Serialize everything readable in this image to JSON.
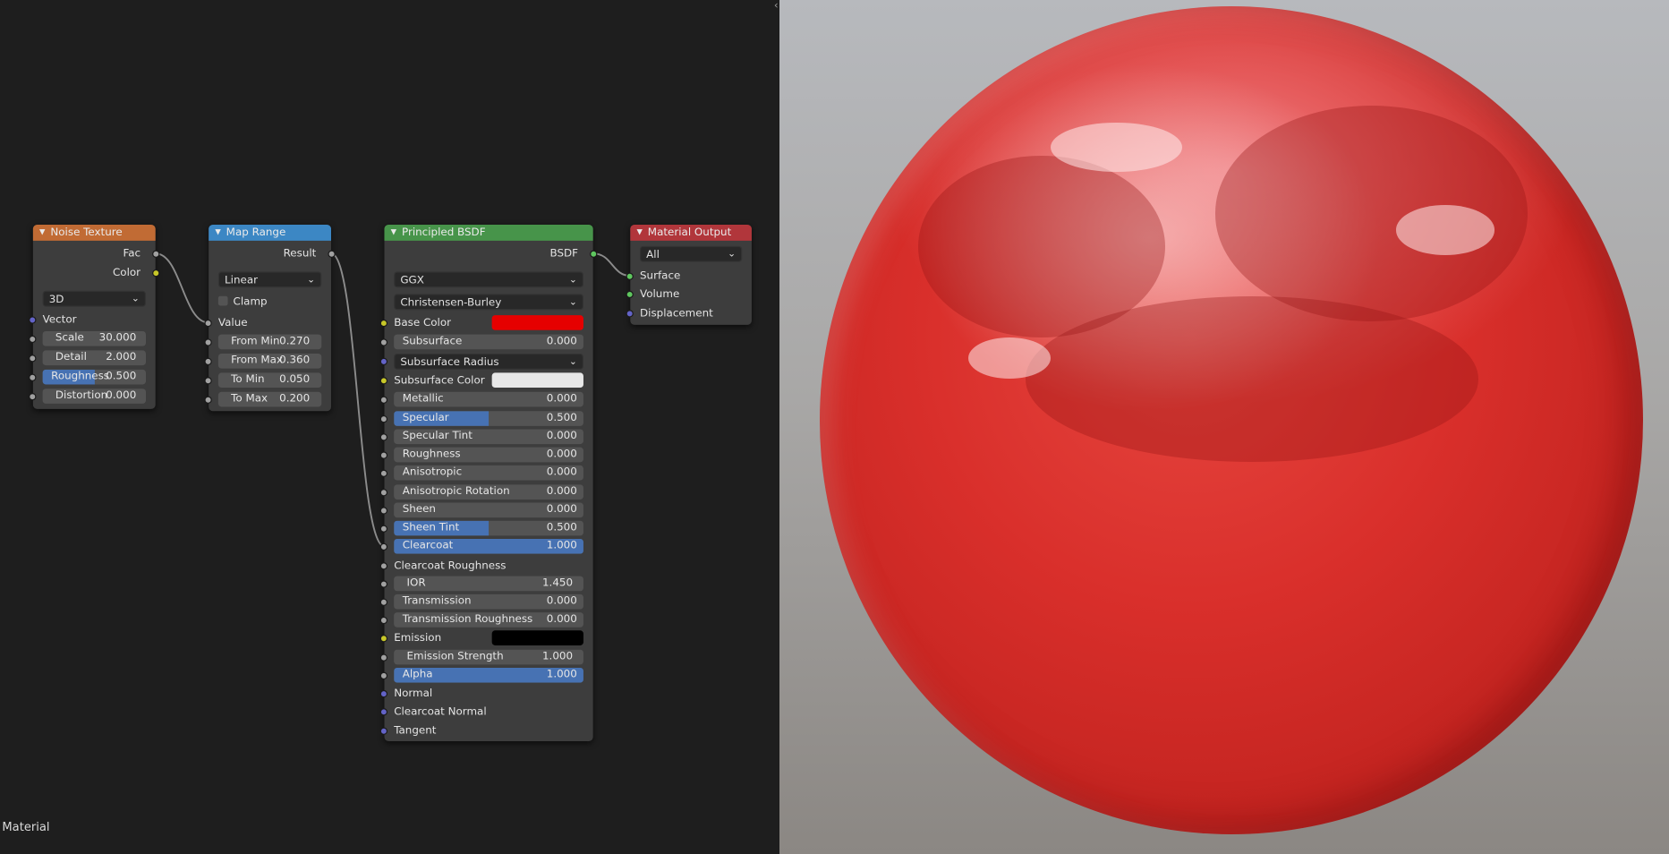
{
  "editor": {
    "label": "Material",
    "collapse_icon": "chevron-left-icon"
  },
  "colors": {
    "noise_header": "#c16b34",
    "map_range_header": "#3c87c4",
    "principled_header": "#47944a",
    "output_header": "#b1363b",
    "base_color": "#e60000",
    "subsurface_color": "#e8e8e8",
    "emission_color": "#000000",
    "slider_fill": "#4772b3"
  },
  "nodes": {
    "noise": {
      "title": "Noise Texture",
      "outputs": {
        "fac": "Fac",
        "color": "Color"
      },
      "dimension": "3D",
      "vector_label": "Vector",
      "scale": {
        "label": "Scale",
        "value": "30.000"
      },
      "detail": {
        "label": "Detail",
        "value": "2.000"
      },
      "roughness": {
        "label": "Roughness",
        "value": "0.500",
        "fill": 0.5
      },
      "distortion": {
        "label": "Distortion",
        "value": "0.000"
      }
    },
    "map_range": {
      "title": "Map Range",
      "output": "Result",
      "interpolation": "Linear",
      "clamp_label": "Clamp",
      "clamp_checked": false,
      "value_label": "Value",
      "from_min": {
        "label": "From Min",
        "value": "0.270"
      },
      "from_max": {
        "label": "From Max",
        "value": "0.360"
      },
      "to_min": {
        "label": "To Min",
        "value": "0.050"
      },
      "to_max": {
        "label": "To Max",
        "value": "0.200"
      }
    },
    "principled": {
      "title": "Principled BSDF",
      "output": "BSDF",
      "distribution": "GGX",
      "subsurface_method": "Christensen-Burley",
      "base_color_label": "Base Color",
      "subsurface": {
        "label": "Subsurface",
        "value": "0.000"
      },
      "subsurface_radius": "Subsurface Radius",
      "subsurface_color_label": "Subsurface Color",
      "metallic": {
        "label": "Metallic",
        "value": "0.000"
      },
      "specular": {
        "label": "Specular",
        "value": "0.500",
        "fill": 0.5
      },
      "specular_tint": {
        "label": "Specular Tint",
        "value": "0.000"
      },
      "roughness": {
        "label": "Roughness",
        "value": "0.000"
      },
      "anisotropic": {
        "label": "Anisotropic",
        "value": "0.000"
      },
      "anisotropic_rotation": {
        "label": "Anisotropic Rotation",
        "value": "0.000"
      },
      "sheen": {
        "label": "Sheen",
        "value": "0.000"
      },
      "sheen_tint": {
        "label": "Sheen Tint",
        "value": "0.500",
        "fill": 0.5
      },
      "clearcoat": {
        "label": "Clearcoat",
        "value": "1.000",
        "fill": 1.0
      },
      "clearcoat_roughness_label": "Clearcoat Roughness",
      "ior": {
        "label": "IOR",
        "value": "1.450"
      },
      "transmission": {
        "label": "Transmission",
        "value": "0.000"
      },
      "transmission_roughness": {
        "label": "Transmission Roughness",
        "value": "0.000"
      },
      "emission_label": "Emission",
      "emission_strength": {
        "label": "Emission Strength",
        "value": "1.000"
      },
      "alpha": {
        "label": "Alpha",
        "value": "1.000",
        "fill": 1.0
      },
      "normal_label": "Normal",
      "clearcoat_normal_label": "Clearcoat Normal",
      "tangent_label": "Tangent"
    },
    "output": {
      "title": "Material Output",
      "target": "All",
      "surface": "Surface",
      "volume": "Volume",
      "displacement": "Displacement"
    }
  }
}
